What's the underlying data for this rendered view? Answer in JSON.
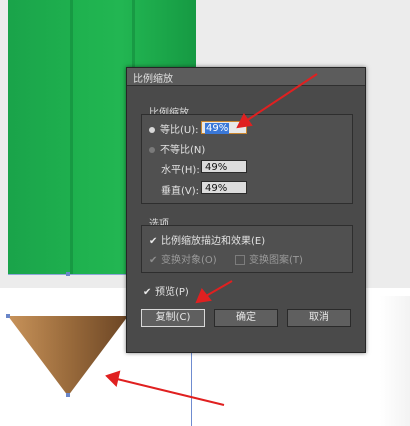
{
  "dialog": {
    "title": "比例缩放",
    "scale_group": {
      "label": "比例缩放",
      "uniform": {
        "label": "等比(U):",
        "value": "49%",
        "selected": true
      },
      "non_uniform": {
        "label": "不等比(N)",
        "selected": false
      },
      "horizontal": {
        "label": "水平(H):",
        "value": "49%"
      },
      "vertical": {
        "label": "垂直(V):",
        "value": "49%"
      }
    },
    "options_group": {
      "label": "选项",
      "scale_strokes": {
        "label": "比例缩放描边和效果(E)",
        "checked": true
      },
      "transform_objects": {
        "label": "变换对象(O)",
        "checked": true
      },
      "transform_patterns": {
        "label": "变换图案(T)",
        "checked": false
      }
    },
    "preview": {
      "label": "预览(P)",
      "checked": true
    },
    "buttons": {
      "copy": "复制(C)",
      "ok": "确定",
      "cancel": "取消"
    }
  },
  "colors": {
    "pencil_green": "#1fb24f",
    "pencil_tip": "#9a6b3c",
    "annotation_arrow": "#e02020"
  }
}
